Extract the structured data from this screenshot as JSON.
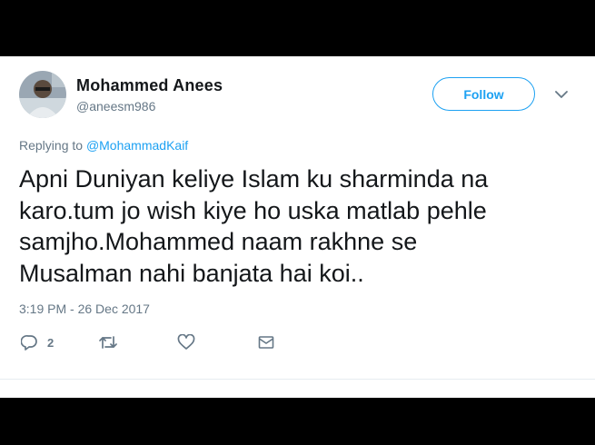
{
  "tweet": {
    "author": {
      "name": "Mohammed Anees",
      "handle": "@aneesm986",
      "avatar": "avatar-photo"
    },
    "follow_label": "Follow",
    "replying_prefix": "Replying to",
    "replying_to": "@MohammadKaif",
    "text_lines": [
      "Apni Duniyan keliye Islam ku sharminda na",
      "karo.tum jo wish kiye ho uska matlab pehle",
      "samjho.Mohammed naam rakhne se",
      "Musalman nahi banjata hai koi.."
    ],
    "timestamp": "3:19 PM - 26 Dec 2017",
    "actions": {
      "reply": {
        "icon": "reply-icon",
        "count": "2"
      },
      "retweet": {
        "icon": "retweet-icon"
      },
      "like": {
        "icon": "heart-icon"
      },
      "message": {
        "icon": "envelope-icon"
      }
    }
  },
  "colors": {
    "accent": "#1da1f2",
    "text": "#14171a",
    "muted": "#657786",
    "frame": "#000000"
  }
}
